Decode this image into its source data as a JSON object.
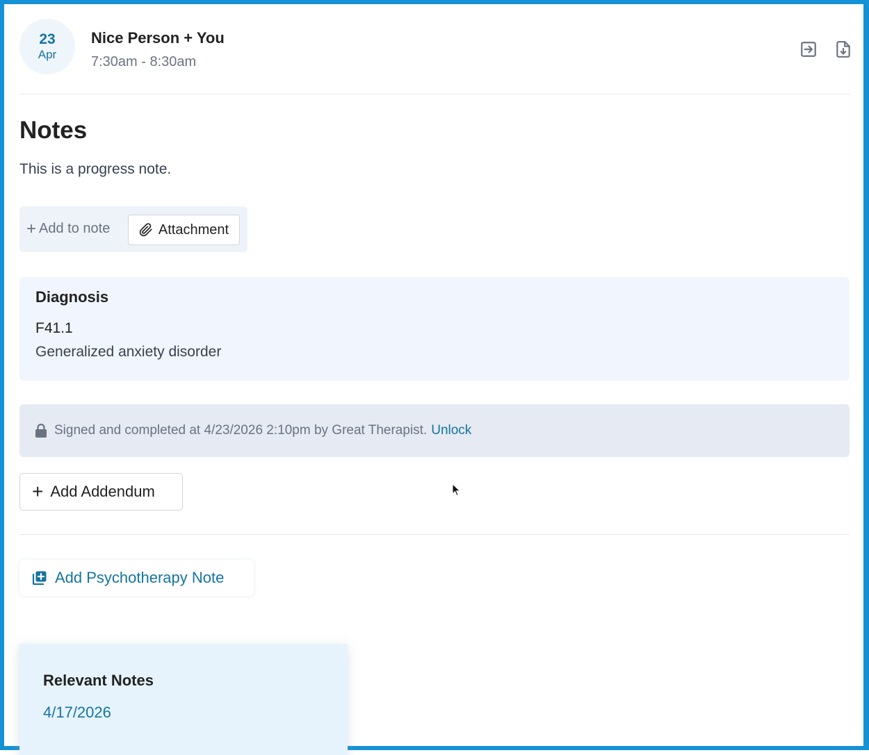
{
  "header": {
    "date_day": "23",
    "date_month": "Apr",
    "title": "Nice Person + You",
    "time": "7:30am - 8:30am",
    "icons": [
      "export-icon",
      "download-file-icon"
    ]
  },
  "notes": {
    "title": "Notes",
    "body": "This is a progress note."
  },
  "add_bar": {
    "add_to_note_label": "Add to note",
    "attachment_label": "Attachment"
  },
  "diagnosis": {
    "title": "Diagnosis",
    "code": "F41.1",
    "description": "Generalized anxiety disorder"
  },
  "signed": {
    "text": "Signed and completed at 4/23/2026 2:10pm by Great Therapist.",
    "unlock_label": "Unlock"
  },
  "addendum": {
    "label": "Add Addendum"
  },
  "psychotherapy": {
    "label": "Add Psychotherapy Note"
  },
  "relevant_notes": {
    "title": "Relevant Notes",
    "items": [
      "4/17/2026"
    ]
  },
  "colors": {
    "frame": "#1592d6",
    "accent": "#15749f",
    "diagnosis_bg": "#f1f5fd",
    "signed_bg": "#e5eaf3",
    "relevant_bg": "#e6f3fd"
  }
}
